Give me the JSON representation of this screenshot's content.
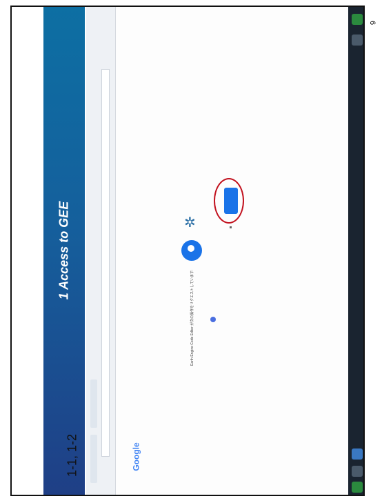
{
  "slide": {
    "title": "1 Access to GEE",
    "subtitle": "1-1, 1-2",
    "page_number": "6"
  },
  "screenshot": {
    "brand_text": "Google",
    "prompt_text": "Earth Engine Code Editor が次の操作をリクエストしています:"
  },
  "colors": {
    "title_band": "#155f9c",
    "highlight": "#c2121f",
    "button": "#1a73e8"
  }
}
